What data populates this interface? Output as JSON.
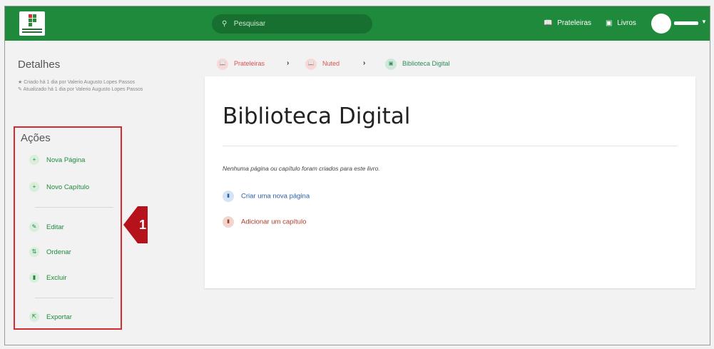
{
  "header": {
    "search_placeholder": "Pesquisar",
    "search_icon": "search-icon",
    "nav": [
      {
        "label": "Prateleiras",
        "icon": "shelves-icon"
      },
      {
        "label": "Livros",
        "icon": "book-icon"
      }
    ],
    "brand_color": "#1f8a3b"
  },
  "sidebar": {
    "details_title": "Detalhes",
    "created": "Criado há 1 dia por Valerio Augusto Lopes Passos",
    "updated": "Atualizado há 1 dia por Valerio Augusto Lopes Passos",
    "actions_title": "Ações",
    "actions": [
      {
        "label": "Nova Página",
        "icon": "plus-icon"
      },
      {
        "label": "Novo Capítulo",
        "icon": "plus-icon"
      },
      {
        "label": "Editar",
        "icon": "edit-icon"
      },
      {
        "label": "Ordenar",
        "icon": "sort-icon"
      },
      {
        "label": "Excluir",
        "icon": "trash-icon"
      },
      {
        "label": "Exportar",
        "icon": "export-icon"
      }
    ],
    "callout_number": "1",
    "callout_color": "#b5121b"
  },
  "breadcrumb": [
    {
      "label": "Prateleiras",
      "color": "#d9534f"
    },
    {
      "label": "Nuted",
      "color": "#d9534f"
    },
    {
      "label": "Biblioteca Digital",
      "color": "#2f8a58"
    }
  ],
  "main": {
    "title": "Biblioteca Digital",
    "empty_message": "Nenhuma página ou capítulo foram criados para este livro.",
    "create_page": "Criar uma nova página",
    "add_chapter": "Adicionar um capítulo"
  }
}
